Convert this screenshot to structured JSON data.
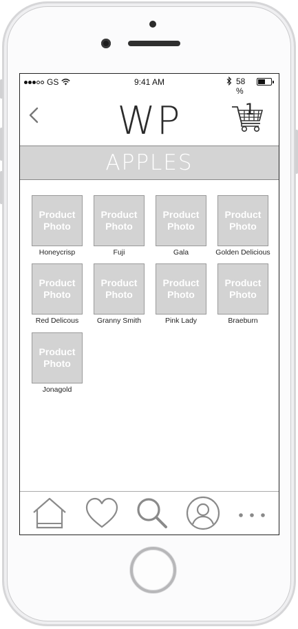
{
  "status_bar": {
    "carrier": "GS",
    "time": "9:41 AM",
    "battery": "58 %",
    "battery_level": 0.58
  },
  "header": {
    "logo": "WP",
    "cart_count": "1"
  },
  "category": {
    "title": "APPLES"
  },
  "products": [
    {
      "photo_label": "Product Photo",
      "name": "Honeycrisp"
    },
    {
      "photo_label": "Product Photo",
      "name": "Fuji"
    },
    {
      "photo_label": "Product Photo",
      "name": "Gala"
    },
    {
      "photo_label": "Product Photo",
      "name": "Golden Delicious"
    },
    {
      "photo_label": "Product Photo",
      "name": "Red Delicous"
    },
    {
      "photo_label": "Product Photo",
      "name": "Granny Smith"
    },
    {
      "photo_label": "Product Photo",
      "name": "Pink Lady"
    },
    {
      "photo_label": "Product Photo",
      "name": "Braeburn"
    },
    {
      "photo_label": "Product Photo",
      "name": "Jonagold"
    }
  ],
  "tab_bar": {
    "items": [
      "home-icon",
      "heart-icon",
      "search-icon",
      "profile-icon",
      "more-icon"
    ]
  },
  "colors": {
    "placeholder": "#d3d3d3",
    "banner": "#d4d4d4",
    "icon_stroke": "#8a8a8a"
  }
}
